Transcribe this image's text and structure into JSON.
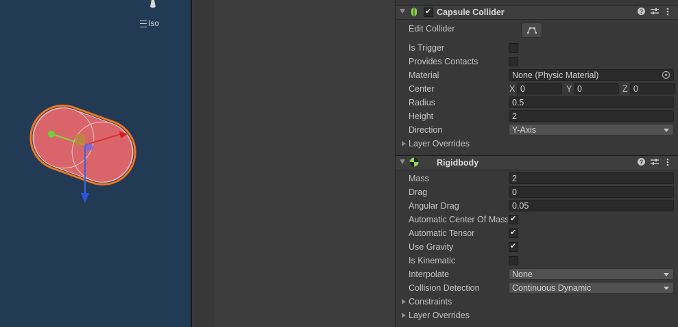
{
  "scene": {
    "view_mode_label": "Iso",
    "background_color": "#233a54"
  },
  "capsule_collider": {
    "title": "Capsule Collider",
    "enabled": true,
    "edit_collider_label": "Edit Collider",
    "is_trigger_label": "Is Trigger",
    "is_trigger": false,
    "provides_contacts_label": "Provides Contacts",
    "provides_contacts": false,
    "material_label": "Material",
    "material_value": "None (Physic Material)",
    "center_label": "Center",
    "center": {
      "x_label": "X",
      "x": "0",
      "y_label": "Y",
      "y": "0",
      "z_label": "Z",
      "z": "0"
    },
    "radius_label": "Radius",
    "radius": "0.5",
    "height_label": "Height",
    "height": "2",
    "direction_label": "Direction",
    "direction": "Y-Axis",
    "layer_overrides_label": "Layer Overrides"
  },
  "rigidbody": {
    "title": "Rigidbody",
    "mass_label": "Mass",
    "mass": "2",
    "drag_label": "Drag",
    "drag": "0",
    "angular_drag_label": "Angular Drag",
    "angular_drag": "0.05",
    "auto_com_label": "Automatic Center Of Mass",
    "auto_com": true,
    "auto_tensor_label": "Automatic Tensor",
    "auto_tensor": true,
    "use_gravity_label": "Use Gravity",
    "use_gravity": true,
    "is_kinematic_label": "Is Kinematic",
    "is_kinematic": false,
    "interpolate_label": "Interpolate",
    "interpolate": "None",
    "collision_detection_label": "Collision Detection",
    "collision_detection": "Continuous Dynamic",
    "constraints_label": "Constraints",
    "layer_overrides_label": "Layer Overrides"
  },
  "header_icons": {
    "help": "?",
    "presets": "⇄",
    "menu": "⋮"
  }
}
